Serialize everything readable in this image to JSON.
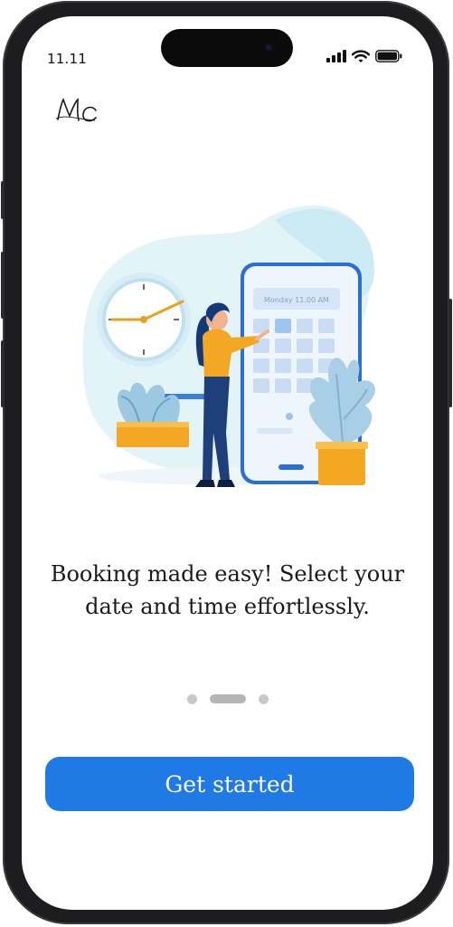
{
  "status_bar": {
    "time": "11.11"
  },
  "brand": {
    "logo_text": "MC"
  },
  "illustration": {
    "phone_header_text": "Monday 11.00 AM",
    "accent_color": "#1f7ae6",
    "blob_color": "#dff3f8"
  },
  "onboarding": {
    "headline": "Booking made easy! Select your date and time effortlessly.",
    "pages": 3,
    "active_page": 2
  },
  "actions": {
    "get_started_label": "Get started"
  },
  "colors": {
    "primary": "#1f7ae6",
    "dot_inactive": "#c8c8c8",
    "dot_active": "#b5b5b5"
  }
}
